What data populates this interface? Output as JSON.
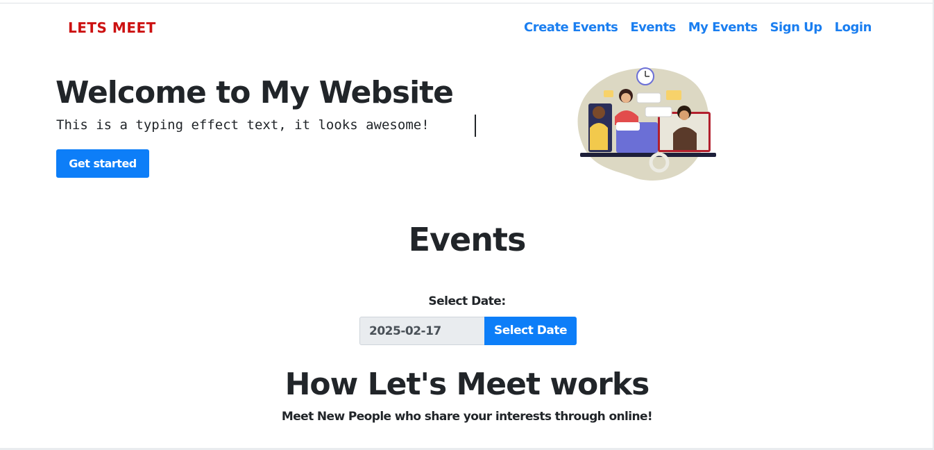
{
  "navbar": {
    "brand": "LETS MEET",
    "links": [
      "Create Events",
      "Events",
      "My Events",
      "Sign Up",
      "Login"
    ]
  },
  "hero": {
    "title": "Welcome to My Website",
    "typing_text": "This is a typing effect text, it looks awesome!",
    "cta_label": "Get started",
    "illustration": "video-call-people-illustration"
  },
  "events": {
    "title": "Events",
    "select_label": "Select Date:",
    "date_value": "2025-02-17",
    "select_button": "Select Date"
  },
  "how": {
    "title": "How Let's Meet works",
    "subtitle": "Meet New People who share your interests through online!"
  },
  "colors": {
    "brand": "#cc1111",
    "link": "#1a7ef0",
    "primary_button": "#0d7ef8"
  }
}
